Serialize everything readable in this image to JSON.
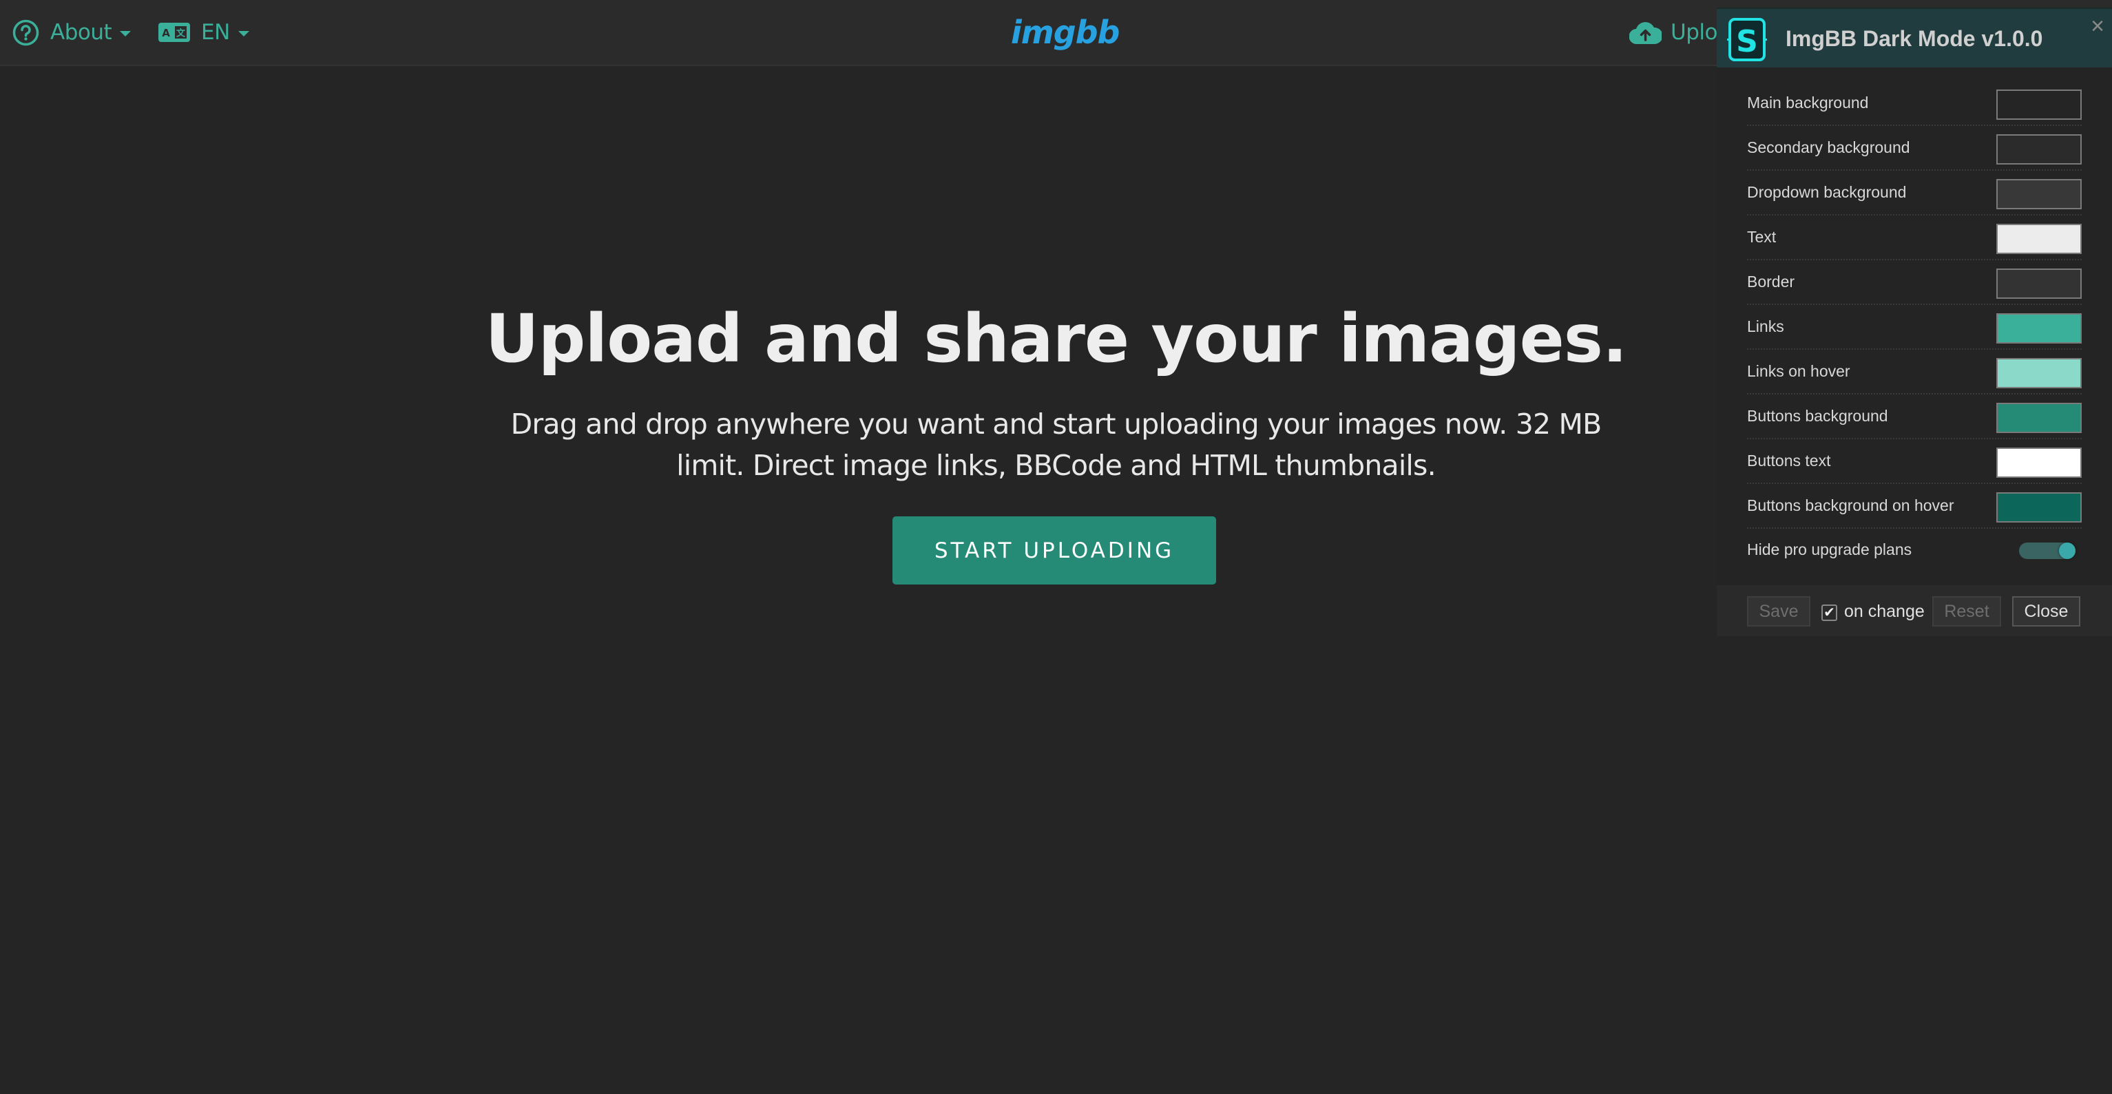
{
  "header": {
    "about_label": "About",
    "lang_label": "EN",
    "upload_label": "Upload",
    "logo_text": "imgbb"
  },
  "hero": {
    "title": "Upload and share your images.",
    "subtitle_lines": [
      "Drag and drop anywhere you want and start uploading your images now. 32 MB",
      "limit. Direct image links, BBCode and HTML thumbnails."
    ],
    "button_label": "START UPLOADING"
  },
  "panel": {
    "title": "ImgBB Dark Mode v1.0.0",
    "close_glyph": "×",
    "rows": [
      {
        "label": "Main background",
        "color": "#252525"
      },
      {
        "label": "Secondary background",
        "color": "#2b2b2b"
      },
      {
        "label": "Dropdown background",
        "color": "#383838"
      },
      {
        "label": "Text",
        "color": "#ececec"
      },
      {
        "label": "Border",
        "color": "#333333"
      },
      {
        "label": "Links",
        "color": "#3ab09a"
      },
      {
        "label": "Links on hover",
        "color": "#8bdac9"
      },
      {
        "label": "Buttons background",
        "color": "#268b76"
      },
      {
        "label": "Buttons text",
        "color": "#ffffff"
      },
      {
        "label": "Buttons background on hover",
        "color": "#0c6659"
      }
    ],
    "toggle": {
      "label": "Hide pro upgrade plans",
      "on": true
    },
    "footer": {
      "save_label": "Save",
      "on_change_label": "on change",
      "on_change_checked": true,
      "check_glyph": "✔",
      "reset_label": "Reset",
      "close_label": "Close"
    }
  }
}
